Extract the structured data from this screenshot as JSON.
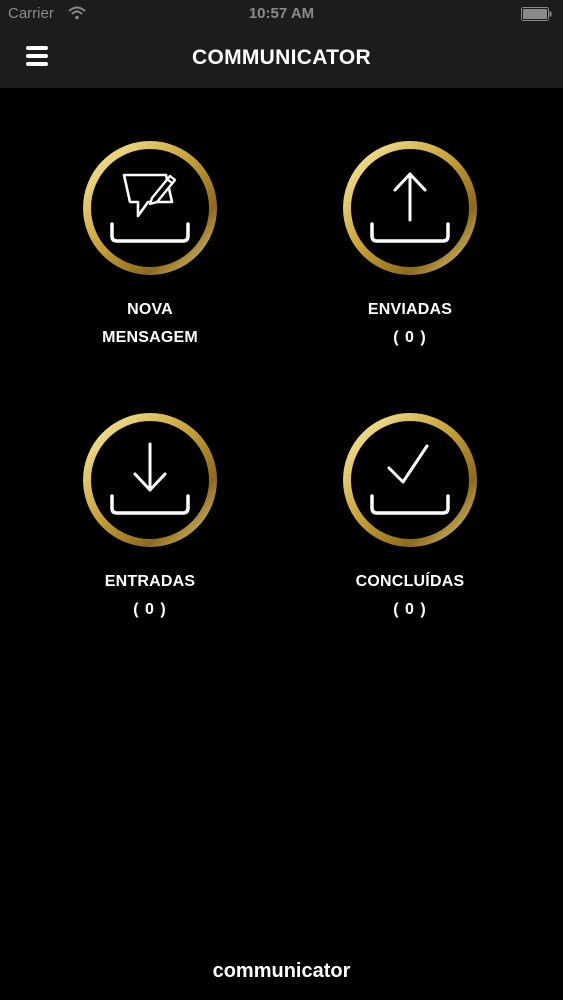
{
  "status_bar": {
    "carrier": "Carrier",
    "time": "10:57 AM"
  },
  "header": {
    "title": "COMMUNICATOR"
  },
  "tiles": [
    {
      "label_line1": "NOVA",
      "label_line2": "MENSAGEM",
      "icon": "compose-icon"
    },
    {
      "label": "ENVIADAS",
      "count": "( 0 )",
      "icon": "upload-tray-icon"
    },
    {
      "label": "ENTRADAS",
      "count": "( 0 )",
      "icon": "download-tray-icon"
    },
    {
      "label": "CONCLUÍDAS",
      "count": "( 0 )",
      "icon": "check-tray-icon"
    }
  ],
  "footer": {
    "brand": "communicator"
  },
  "colors": {
    "background": "#000000",
    "bar": "#1c1c1c",
    "gold_light": "#f3e08a",
    "gold_dark": "#9a7a22"
  }
}
